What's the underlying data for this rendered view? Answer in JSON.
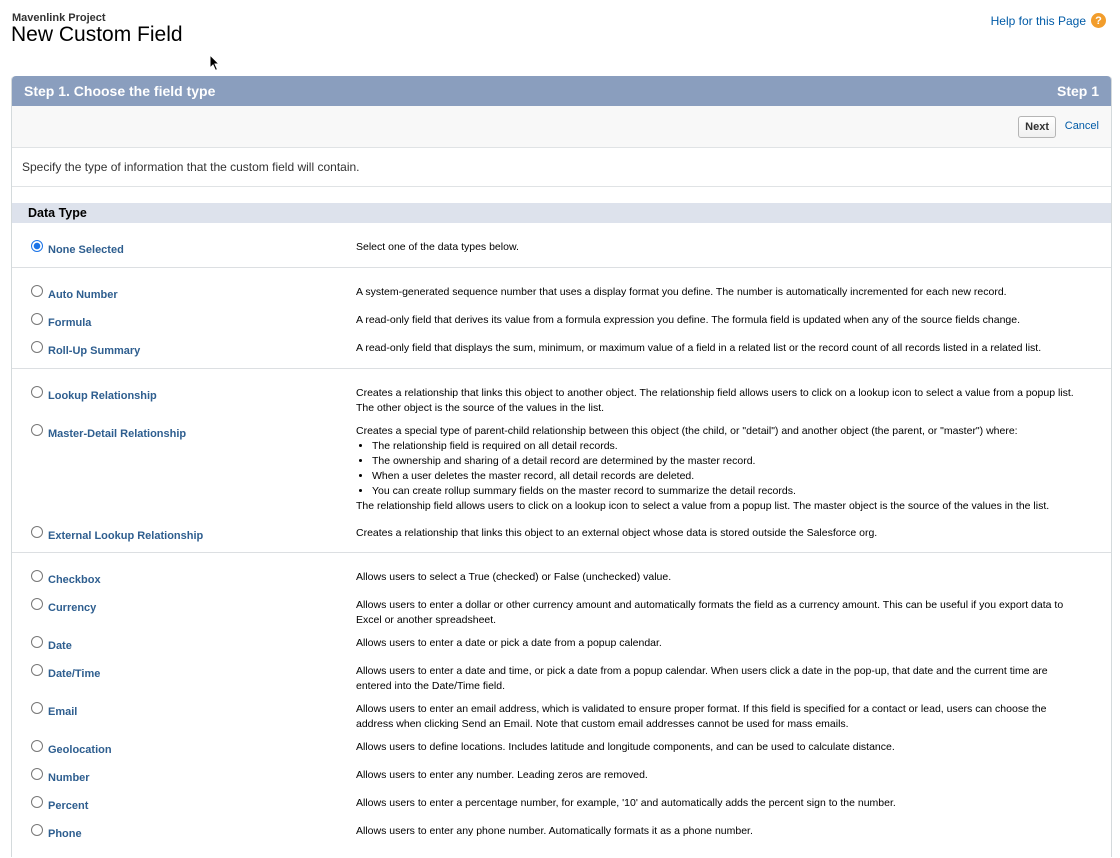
{
  "header": {
    "object_name": "Mavenlink Project",
    "title": "New Custom Field",
    "help_link": "Help for this Page",
    "help_icon": "?"
  },
  "step": {
    "title": "Step 1. Choose the field type",
    "indicator": "Step 1"
  },
  "buttons": {
    "next": "Next",
    "cancel": "Cancel"
  },
  "instructions": "Specify the type of information that the custom field will contain.",
  "section_title": "Data Type",
  "types": {
    "none": {
      "label": "None Selected",
      "desc": "Select one of the data types below.",
      "selected": true
    },
    "auto_number": {
      "label": "Auto Number",
      "desc": "A system-generated sequence number that uses a display format you define. The number is automatically incremented for each new record."
    },
    "formula": {
      "label": "Formula",
      "desc": "A read-only field that derives its value from a formula expression you define. The formula field is updated when any of the source fields change."
    },
    "rollup": {
      "label": "Roll-Up Summary",
      "desc": "A read-only field that displays the sum, minimum, or maximum value of a field in a related list or the record count of all records listed in a related list."
    },
    "lookup": {
      "label": "Lookup Relationship",
      "desc": "Creates a relationship that links this object to another object. The relationship field allows users to click on a lookup icon to select a value from a popup list. The other object is the source of the values in the list."
    },
    "master_detail": {
      "label": "Master-Detail Relationship",
      "desc_intro": "Creates a special type of parent-child relationship between this object (the child, or \"detail\") and another object (the parent, or \"master\") where:",
      "bullets": [
        "The relationship field is required on all detail records.",
        "The ownership and sharing of a detail record are determined by the master record.",
        "When a user deletes the master record, all detail records are deleted.",
        "You can create rollup summary fields on the master record to summarize the detail records."
      ],
      "desc_outro": "The relationship field allows users to click on a lookup icon to select a value from a popup list. The master object is the source of the values in the list."
    },
    "external_lookup": {
      "label": "External Lookup Relationship",
      "desc": "Creates a relationship that links this object to an external object whose data is stored outside the Salesforce org."
    },
    "checkbox": {
      "label": "Checkbox",
      "desc": "Allows users to select a True (checked) or False (unchecked) value."
    },
    "currency": {
      "label": "Currency",
      "desc": "Allows users to enter a dollar or other currency amount and automatically formats the field as a currency amount. This can be useful if you export data to Excel or another spreadsheet."
    },
    "date": {
      "label": "Date",
      "desc": "Allows users to enter a date or pick a date from a popup calendar."
    },
    "datetime": {
      "label": "Date/Time",
      "desc": "Allows users to enter a date and time, or pick a date from a popup calendar. When users click a date in the pop-up, that date and the current time are entered into the Date/Time field."
    },
    "email": {
      "label": "Email",
      "desc": "Allows users to enter an email address, which is validated to ensure proper format. If this field is specified for a contact or lead, users can choose the address when clicking Send an Email. Note that custom email addresses cannot be used for mass emails."
    },
    "geolocation": {
      "label": "Geolocation",
      "desc": "Allows users to define locations. Includes latitude and longitude components, and can be used to calculate distance."
    },
    "number": {
      "label": "Number",
      "desc": "Allows users to enter any number. Leading zeros are removed."
    },
    "percent": {
      "label": "Percent",
      "desc": "Allows users to enter a percentage number, for example, '10' and automatically adds the percent sign to the number."
    },
    "phone": {
      "label": "Phone",
      "desc": "Allows users to enter any phone number. Automatically formats it as a phone number."
    }
  }
}
